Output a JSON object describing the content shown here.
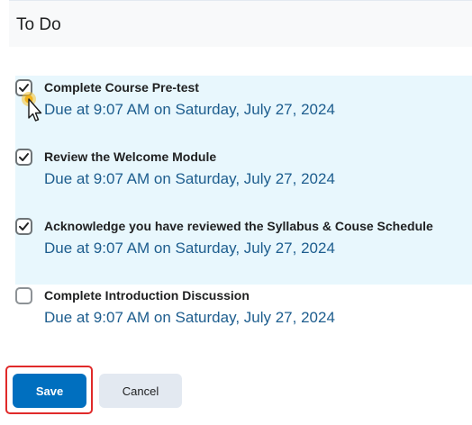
{
  "header": {
    "title": "To Do"
  },
  "tasks": [
    {
      "title": "Complete Course Pre-test",
      "due": "Due at 9:07 AM on Saturday, July 27, 2024",
      "checked": true
    },
    {
      "title": "Review the Welcome Module",
      "due": "Due at 9:07 AM on Saturday, July 27, 2024",
      "checked": true
    },
    {
      "title": "Acknowledge you have reviewed the Syllabus & Couse Schedule",
      "due": "Due at 9:07 AM on Saturday, July 27, 2024",
      "checked": true
    },
    {
      "title": "Complete Introduction Discussion",
      "due": "Due at 9:07 AM on Saturday, July 27, 2024",
      "checked": false
    }
  ],
  "actions": {
    "save_label": "Save",
    "cancel_label": "Cancel"
  },
  "colors": {
    "accent": "#006fbf",
    "checked_row_background": "#e8f7fd",
    "due_text": "#1d5d8e",
    "highlight": "#e02a2a"
  },
  "icons": {
    "checkbox_checked": "checkmark-icon",
    "cursor": "mouse-pointer-icon"
  }
}
